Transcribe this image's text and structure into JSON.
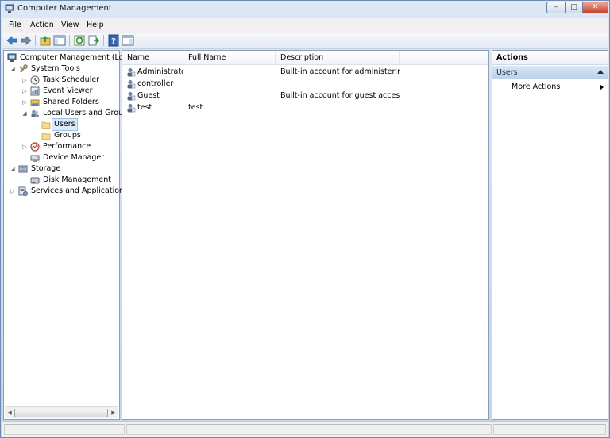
{
  "window": {
    "title": "Computer Management",
    "controls": {
      "minimize": "–",
      "maximize": "□",
      "close": "✕"
    }
  },
  "menu": [
    "File",
    "Action",
    "View",
    "Help"
  ],
  "tree": [
    {
      "label": "Computer Management (Local",
      "icon": "computer-icon",
      "level": 0,
      "expander": ""
    },
    {
      "label": "System Tools",
      "icon": "tools-icon",
      "level": 1,
      "expander": "◢"
    },
    {
      "label": "Task Scheduler",
      "icon": "clock-icon",
      "level": 2,
      "expander": "▷"
    },
    {
      "label": "Event Viewer",
      "icon": "event-viewer-icon",
      "level": 2,
      "expander": "▷"
    },
    {
      "label": "Shared Folders",
      "icon": "shared-folder-icon",
      "level": 2,
      "expander": "▷"
    },
    {
      "label": "Local Users and Groups",
      "icon": "users-groups-icon",
      "level": 2,
      "expander": "◢"
    },
    {
      "label": "Users",
      "icon": "folder-icon",
      "level": 3,
      "expander": "",
      "selected": true
    },
    {
      "label": "Groups",
      "icon": "folder-icon",
      "level": 3,
      "expander": ""
    },
    {
      "label": "Performance",
      "icon": "performance-icon",
      "level": 2,
      "expander": "▷"
    },
    {
      "label": "Device Manager",
      "icon": "device-manager-icon",
      "level": 2,
      "expander": ""
    },
    {
      "label": "Storage",
      "icon": "storage-icon",
      "level": 1,
      "expander": "◢"
    },
    {
      "label": "Disk Management",
      "icon": "disk-icon",
      "level": 2,
      "expander": ""
    },
    {
      "label": "Services and Applications",
      "icon": "services-icon",
      "level": 1,
      "expander": "▷"
    }
  ],
  "list": {
    "columns": [
      "Name",
      "Full Name",
      "Description"
    ],
    "rows": [
      {
        "name": "Administrator",
        "full_name": "",
        "description": "Built-in account for administering..."
      },
      {
        "name": "controller",
        "full_name": "",
        "description": ""
      },
      {
        "name": "Guest",
        "full_name": "",
        "description": "Built-in account for guest access t..."
      },
      {
        "name": "test",
        "full_name": "test",
        "description": ""
      }
    ]
  },
  "actions": {
    "header": "Actions",
    "group": "Users",
    "items": [
      "More Actions"
    ]
  },
  "colors": {
    "accent": "#b9d0ea",
    "selection": "#dcebfc"
  }
}
